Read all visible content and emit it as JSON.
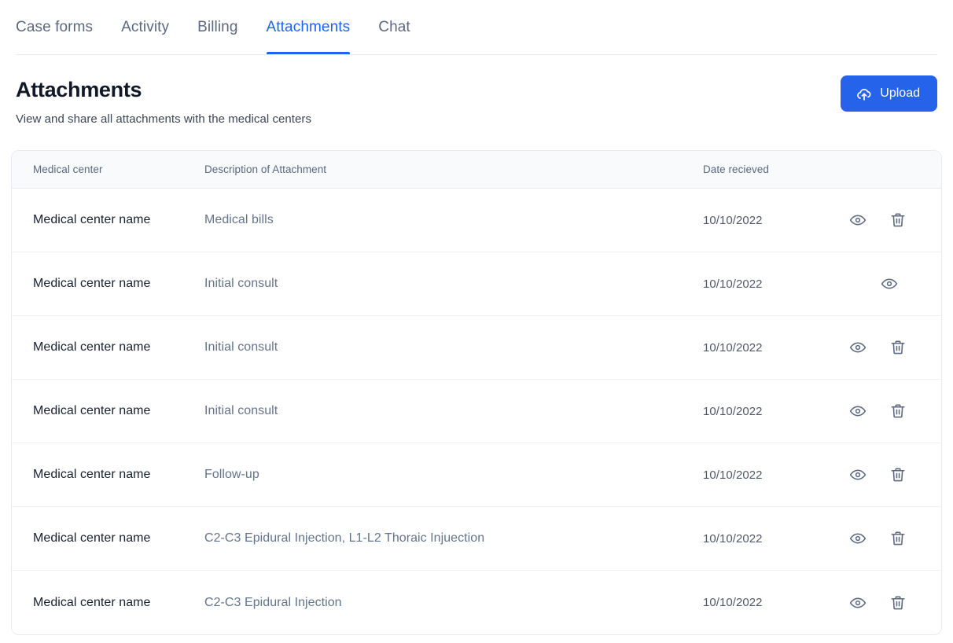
{
  "tabs": [
    {
      "label": "Case forms",
      "active": false
    },
    {
      "label": "Activity",
      "active": false
    },
    {
      "label": "Billing",
      "active": false
    },
    {
      "label": "Attachments",
      "active": true
    },
    {
      "label": "Chat",
      "active": false
    }
  ],
  "header": {
    "title": "Attachments",
    "subtitle": "View and share all attachments with the medical centers",
    "upload_label": "Upload"
  },
  "table": {
    "columns": [
      "Medical center",
      "Description of Attachment",
      "Date recieved"
    ],
    "rows": [
      {
        "medical_center": "Medical center name",
        "description": "Medical bills",
        "date": "10/10/2022",
        "has_view": true,
        "has_delete": true
      },
      {
        "medical_center": "Medical center name",
        "description": "Initial consult",
        "date": "10/10/2022",
        "has_view": true,
        "has_delete": false
      },
      {
        "medical_center": "Medical center name",
        "description": "Initial consult",
        "date": "10/10/2022",
        "has_view": true,
        "has_delete": true
      },
      {
        "medical_center": "Medical center name",
        "description": "Initial consult",
        "date": "10/10/2022",
        "has_view": true,
        "has_delete": true
      },
      {
        "medical_center": "Medical center name",
        "description": "Follow-up",
        "date": "10/10/2022",
        "has_view": true,
        "has_delete": true
      },
      {
        "medical_center": "Medical center name",
        "description": "C2-C3 Epidural Injection, L1-L2 Thoraic Injuection",
        "date": "10/10/2022",
        "has_view": true,
        "has_delete": true
      },
      {
        "medical_center": "Medical center name",
        "description": "C2-C3 Epidural Injection",
        "date": "10/10/2022",
        "has_view": true,
        "has_delete": true
      }
    ]
  },
  "icons": {
    "upload": "cloud-upload-icon",
    "view": "eye-icon",
    "delete": "trash-icon"
  },
  "colors": {
    "accent": "#2563EB",
    "tab_active": "#1C64F2",
    "tab_inactive": "#5B6880",
    "header_bg": "#F8FAFC",
    "border": "#E8EBF0",
    "icon": "#5B6880"
  }
}
